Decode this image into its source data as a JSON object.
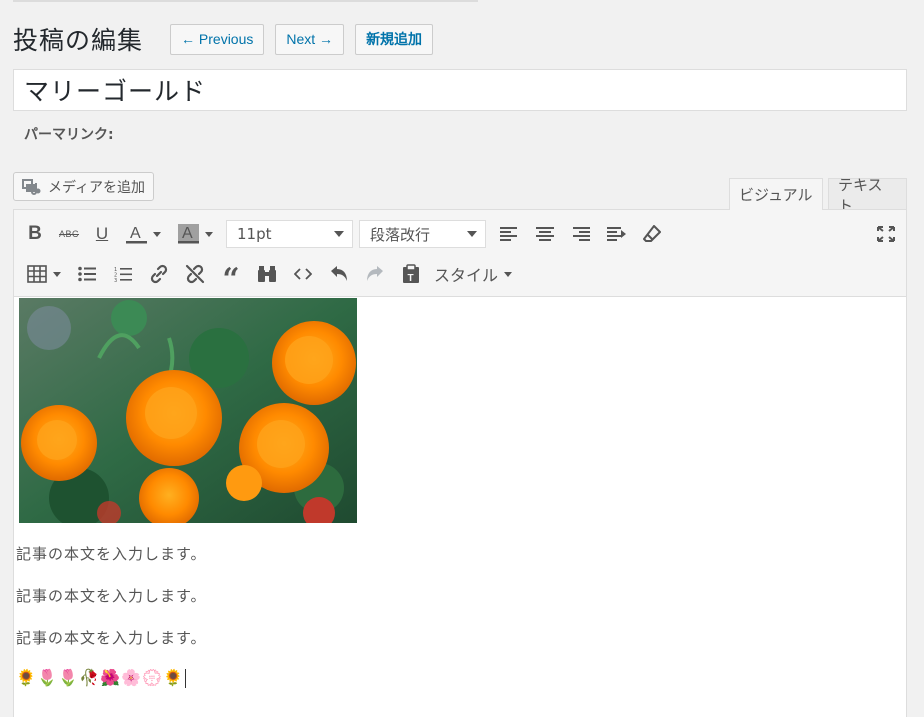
{
  "heading": {
    "title": "投稿の編集",
    "previous_label": "← Previous",
    "next_label": "Next →",
    "add_new_label": "新規追加"
  },
  "post": {
    "title": "マリーゴールド",
    "permalink_label": "パーマリンク:"
  },
  "media": {
    "add_media_label": "メディアを追加"
  },
  "editor_tabs": {
    "visual": "ビジュアル",
    "text": "テキスト"
  },
  "toolbar": {
    "font_size": "11pt",
    "format": "段落改行",
    "styles": "スタイル",
    "icons_row1": [
      "bold-icon",
      "strikethrough-icon",
      "underline-icon",
      "text-color-icon",
      "background-color-icon",
      "align-left-icon",
      "align-center-icon",
      "align-right-icon",
      "wrap-text-icon",
      "eraser-icon",
      "fullscreen-icon"
    ],
    "icons_row2": [
      "table-icon",
      "bullet-list-icon",
      "numbered-list-icon",
      "link-icon",
      "unlink-icon",
      "blockquote-icon",
      "find-icon",
      "code-icon",
      "undo-icon",
      "redo-icon",
      "paste-icon"
    ]
  },
  "content": {
    "image_alt": "marigold-photo",
    "paragraphs": [
      "記事の本文を入力します。",
      "記事の本文を入力します。",
      "記事の本文を入力します。"
    ],
    "emojis": [
      "🌻",
      "🌷",
      "🌷",
      "🥀",
      "🌺",
      "🌸",
      "💮",
      "🌻"
    ]
  },
  "colors": {
    "link_blue": "#0073aa",
    "border": "#dddddd",
    "toolbar_bg": "#f5f5f5",
    "page_bg": "#f1f1f1"
  }
}
